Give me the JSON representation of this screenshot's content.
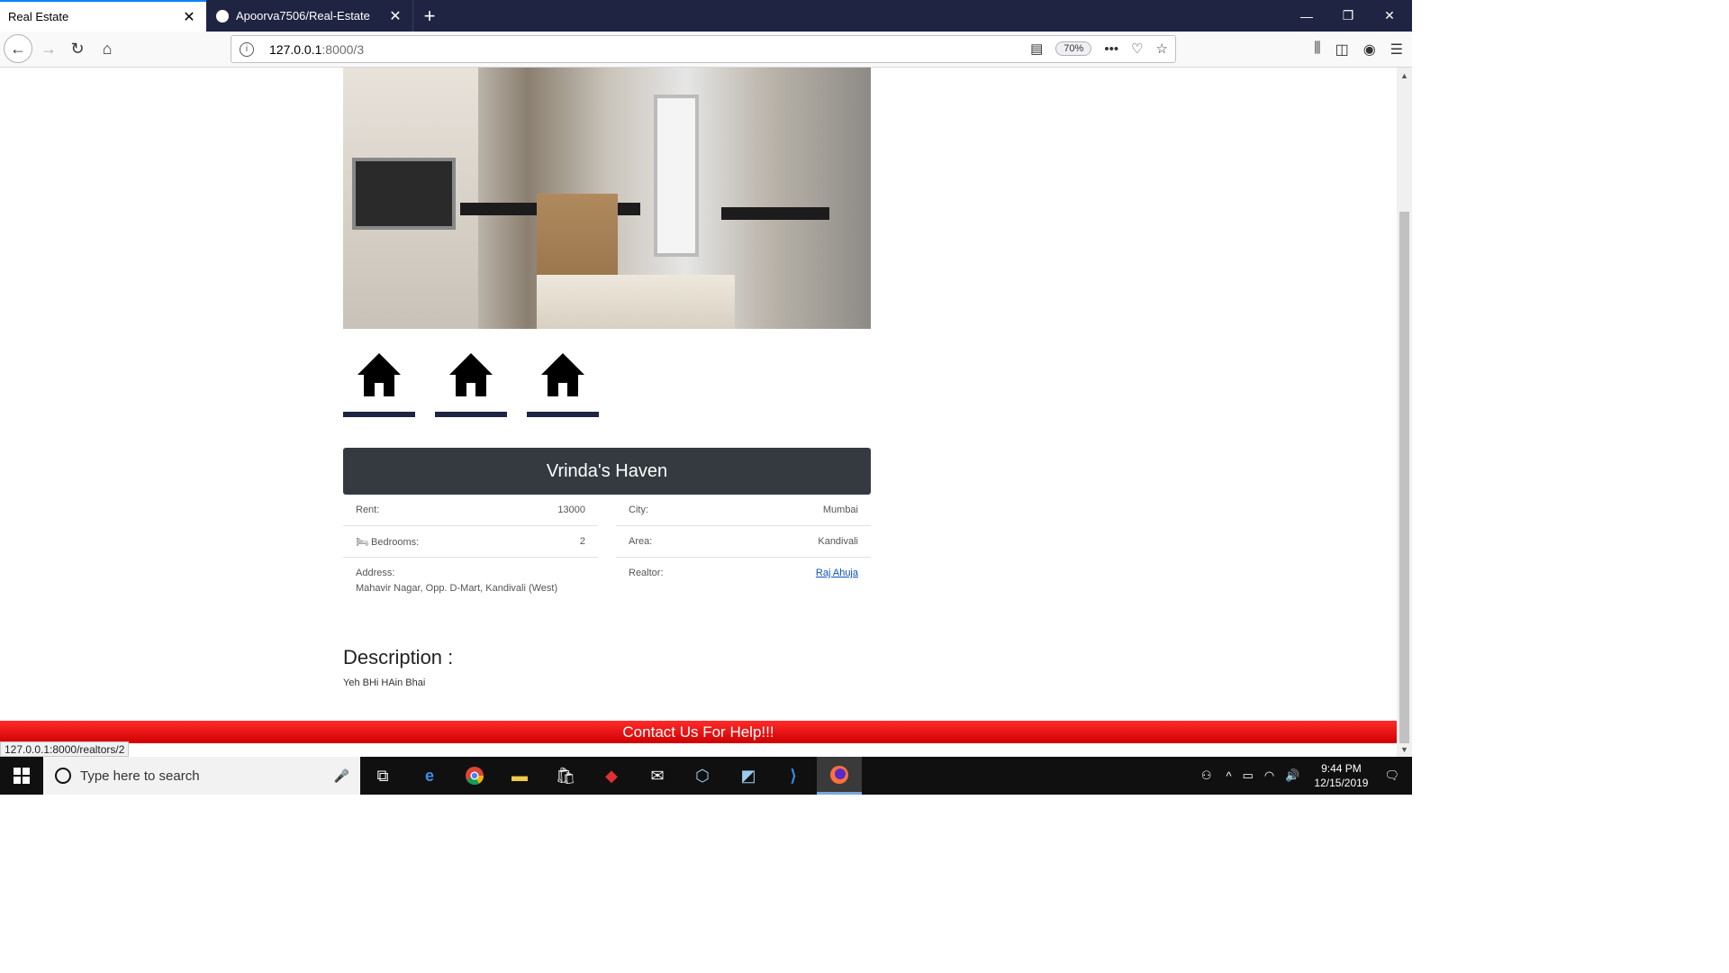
{
  "browser": {
    "tabs": [
      {
        "label": "Real Estate",
        "active": true
      },
      {
        "label": "Apoorva7506/Real-Estate",
        "active": false
      }
    ],
    "new_tab": "+",
    "url_host": "127.0.0.1",
    "url_path": ":8000/3",
    "zoom": "70%",
    "status_url": "127.0.0.1:8000/realtors/2"
  },
  "listing": {
    "title": "Vrinda's Haven",
    "rent_label": "Rent:",
    "rent_value": "13000",
    "city_label": "City:",
    "city_value": "Mumbai",
    "bedrooms_label": "Bedrooms:",
    "bedrooms_value": "2",
    "area_label": "Area:",
    "area_value": "Kandivali",
    "address_label": "Address:",
    "address_value": "Mahavir Nagar, Opp. D-Mart, Kandivali (West)",
    "realtor_label": "Realtor:",
    "realtor_value": "Raj Ahuja",
    "description_heading": "Description :",
    "description_text": "Yeh BHi HAin Bhai",
    "footer_text": "Contact Us For Help!!!"
  },
  "taskbar": {
    "search_placeholder": "Type here to search",
    "time": "9:44 PM",
    "date": "12/15/2019"
  },
  "colors": {
    "titlebar": "#343a40",
    "footer": "#ff0000",
    "tabbar": "#1f2442",
    "link": "#0a53be"
  }
}
